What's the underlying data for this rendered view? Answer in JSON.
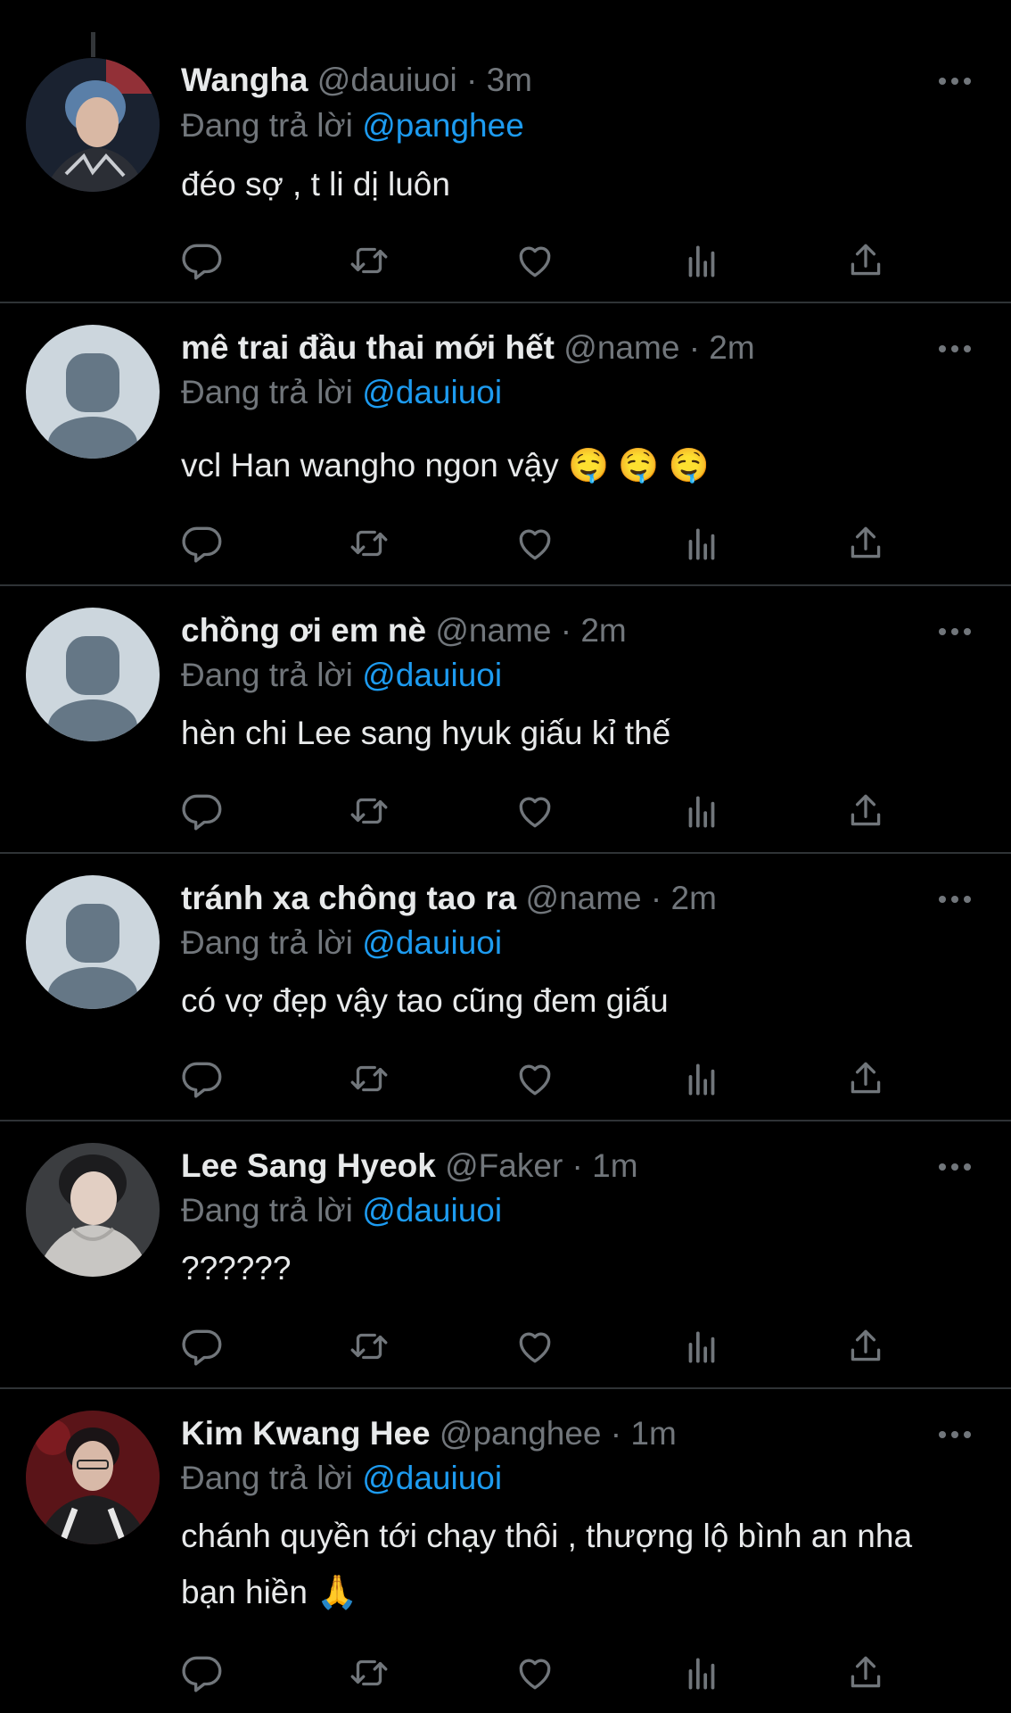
{
  "replying_to_label": "Đang trả lời",
  "tweets": [
    {
      "name": "Wangha",
      "handle": "@dauiuoi",
      "sep": "·",
      "time": "3m",
      "reply_to": "@panghee",
      "text": "đéo sợ , t li dị luôn",
      "avatar": "photo"
    },
    {
      "name": "mê trai đầu thai mới hết",
      "handle": "@name",
      "sep": "·",
      "time": "2m",
      "reply_to": "@dauiuoi",
      "text": "vcl Han wangho ngon vậy 🤤 🤤 🤤",
      "avatar": "default"
    },
    {
      "name": "chồng ơi em nè",
      "handle": "@name",
      "sep": "·",
      "time": "2m",
      "reply_to": "@dauiuoi",
      "text": "hèn chi Lee sang hyuk giấu kỉ thế",
      "avatar": "default"
    },
    {
      "name": "tránh xa chông tao ra",
      "handle": "@name",
      "sep": "·",
      "time": "2m",
      "reply_to": "@dauiuoi",
      "text": "có vợ đẹp vậy tao cũng đem giấu",
      "avatar": "default"
    },
    {
      "name": "Lee Sang Hyeok",
      "handle": "@Faker",
      "sep": "·",
      "time": "1m",
      "reply_to": "@dauiuoi",
      "text": "??????",
      "avatar": "photo"
    },
    {
      "name": "Kim Kwang Hee",
      "handle": "@panghee",
      "sep": "·",
      "time": "1m",
      "reply_to": "@dauiuoi",
      "text": "chánh quyền tới chạy thôi , thượng lộ bình an nha bạn hiền 🙏",
      "avatar": "photo"
    }
  ],
  "action_icons": [
    "reply-icon",
    "retweet-icon",
    "like-icon",
    "views-icon",
    "share-icon"
  ],
  "colors": {
    "background": "#000000",
    "text": "#e7e9ea",
    "secondary": "#71767b",
    "mention": "#1d9bf0",
    "divider": "#2f3336"
  }
}
